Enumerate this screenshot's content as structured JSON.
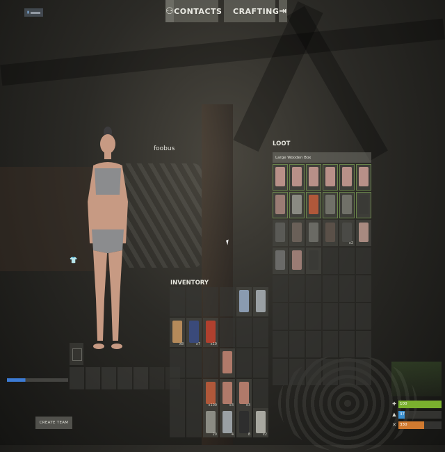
{
  "topnav": {
    "contacts_label": "CONTACTS",
    "crafting_label": "CRAFTING",
    "contacts_icon": "people-icon",
    "crafting_icon": "exit-arrow-icon"
  },
  "server_badge": "",
  "player": {
    "name": "foobus"
  },
  "team": {
    "create_label": "CREATE TEAM"
  },
  "inventory": {
    "title": "INVENTORY",
    "rows": [
      [
        {
          "item": "",
          "qty": ""
        },
        {
          "item": "",
          "qty": ""
        },
        {
          "item": "",
          "qty": ""
        },
        {
          "item": "",
          "qty": ""
        },
        {
          "item": "can",
          "qty": "",
          "color": "#8a9bb0"
        },
        {
          "item": "pistol",
          "qty": "",
          "color": "#9aa0a4"
        }
      ],
      [
        {
          "item": "knife",
          "qty": "x8",
          "color": "#b58a5a"
        },
        {
          "item": "shotgun-ammo",
          "qty": "x7",
          "color": "#3a4a7a"
        },
        {
          "item": "rocket",
          "qty": "x10",
          "color": "#b0402e"
        },
        {
          "item": "",
          "qty": ""
        },
        {
          "item": "",
          "qty": ""
        },
        {
          "item": "",
          "qty": ""
        }
      ],
      [
        {
          "item": "",
          "qty": ""
        },
        {
          "item": "",
          "qty": ""
        },
        {
          "item": "",
          "qty": ""
        },
        {
          "item": "meat",
          "qty": "",
          "color": "#b07a6a"
        },
        {
          "item": "",
          "qty": ""
        },
        {
          "item": "",
          "qty": ""
        }
      ],
      [
        {
          "item": "",
          "qty": ""
        },
        {
          "item": "",
          "qty": ""
        },
        {
          "item": "ammo",
          "qty": "x109",
          "color": "#b0583a"
        },
        {
          "item": "meat",
          "qty": "x3",
          "color": "#b07a6a"
        },
        {
          "item": "meat",
          "qty": "x3",
          "color": "#b07a6a"
        },
        {
          "item": "",
          "qty": ""
        }
      ]
    ],
    "belt": [
      {
        "item": "",
        "qty": ""
      },
      {
        "item": "",
        "qty": ""
      },
      {
        "item": "hatchet",
        "qty": "20",
        "color": "#8c8c84"
      },
      {
        "item": "revolver",
        "qty": "4",
        "color": "#9aa0a4"
      },
      {
        "item": "pistol",
        "qty": "8",
        "color": "#2e2e2e"
      },
      {
        "item": "knife",
        "qty": "x2",
        "color": "#a8a8a0"
      }
    ]
  },
  "loot": {
    "title": "LOOT",
    "container_name": "Large Wooden Box",
    "cells": [
      {
        "item": "box",
        "qty": "",
        "color": "#b89088"
      },
      {
        "item": "box",
        "qty": "",
        "color": "#b89088"
      },
      {
        "item": "box",
        "qty": "",
        "color": "#b89088"
      },
      {
        "item": "box",
        "qty": "",
        "color": "#b89088"
      },
      {
        "item": "box",
        "qty": "",
        "color": "#b89088"
      },
      {
        "item": "box",
        "qty": "",
        "color": "#b89088"
      },
      {
        "item": "crate",
        "qty": "",
        "color": "#9a7c74"
      },
      {
        "item": "tool",
        "qty": "",
        "color": "#8a8a82"
      },
      {
        "item": "rocket",
        "qty": "",
        "color": "#b0583a"
      },
      {
        "item": "lantern",
        "qty": "",
        "color": "#707068"
      },
      {
        "item": "lantern",
        "qty": "",
        "color": "#707068"
      },
      {
        "item": "locker",
        "qty": "",
        "color": "#3a3a36"
      },
      {
        "item": "trap",
        "qty": "",
        "color": "#5a5a56"
      },
      {
        "item": "barrel",
        "qty": "",
        "color": "#6a6058"
      },
      {
        "item": "rifle",
        "qty": "",
        "color": "#6a6a64"
      },
      {
        "item": "cabinet",
        "qty": "",
        "color": "#5a5048"
      },
      {
        "item": "rack",
        "qty": "x2",
        "color": "#4a4a46"
      },
      {
        "item": "box",
        "qty": "",
        "color": "#a88a80"
      },
      {
        "item": "tire",
        "qty": "",
        "color": "#6a6a68"
      },
      {
        "item": "crate",
        "qty": "",
        "color": "#9a7c74"
      },
      {
        "item": "locker",
        "qty": "",
        "color": "#3a3a36"
      },
      {
        "item": "",
        "qty": ""
      },
      {
        "item": "",
        "qty": ""
      },
      {
        "item": "",
        "qty": ""
      },
      {
        "item": "",
        "qty": ""
      },
      {
        "item": "",
        "qty": ""
      },
      {
        "item": "",
        "qty": ""
      },
      {
        "item": "",
        "qty": ""
      },
      {
        "item": "",
        "qty": ""
      },
      {
        "item": "",
        "qty": ""
      },
      {
        "item": "",
        "qty": ""
      },
      {
        "item": "",
        "qty": ""
      },
      {
        "item": "",
        "qty": ""
      },
      {
        "item": "",
        "qty": ""
      },
      {
        "item": "",
        "qty": ""
      },
      {
        "item": "",
        "qty": ""
      },
      {
        "item": "",
        "qty": ""
      },
      {
        "item": "",
        "qty": ""
      },
      {
        "item": "",
        "qty": ""
      },
      {
        "item": "",
        "qty": ""
      },
      {
        "item": "",
        "qty": ""
      },
      {
        "item": "",
        "qty": ""
      },
      {
        "item": "",
        "qty": ""
      },
      {
        "item": "",
        "qty": ""
      },
      {
        "item": "",
        "qty": ""
      },
      {
        "item": "",
        "qty": ""
      },
      {
        "item": "",
        "qty": ""
      },
      {
        "item": "",
        "qty": ""
      }
    ]
  },
  "stats": [
    {
      "name": "health",
      "icon": "plus-icon",
      "glyph": "✚",
      "value": "100",
      "fill": 1.0,
      "color": "#7ab02e"
    },
    {
      "name": "thirst",
      "icon": "water-drop-icon",
      "glyph": "▲",
      "value": "37",
      "fill": 0.14,
      "color": "#3a8fd0"
    },
    {
      "name": "hunger",
      "icon": "fork-knife-icon",
      "glyph": "✕",
      "value": "330",
      "fill": 0.6,
      "color": "#d07a30"
    }
  ]
}
